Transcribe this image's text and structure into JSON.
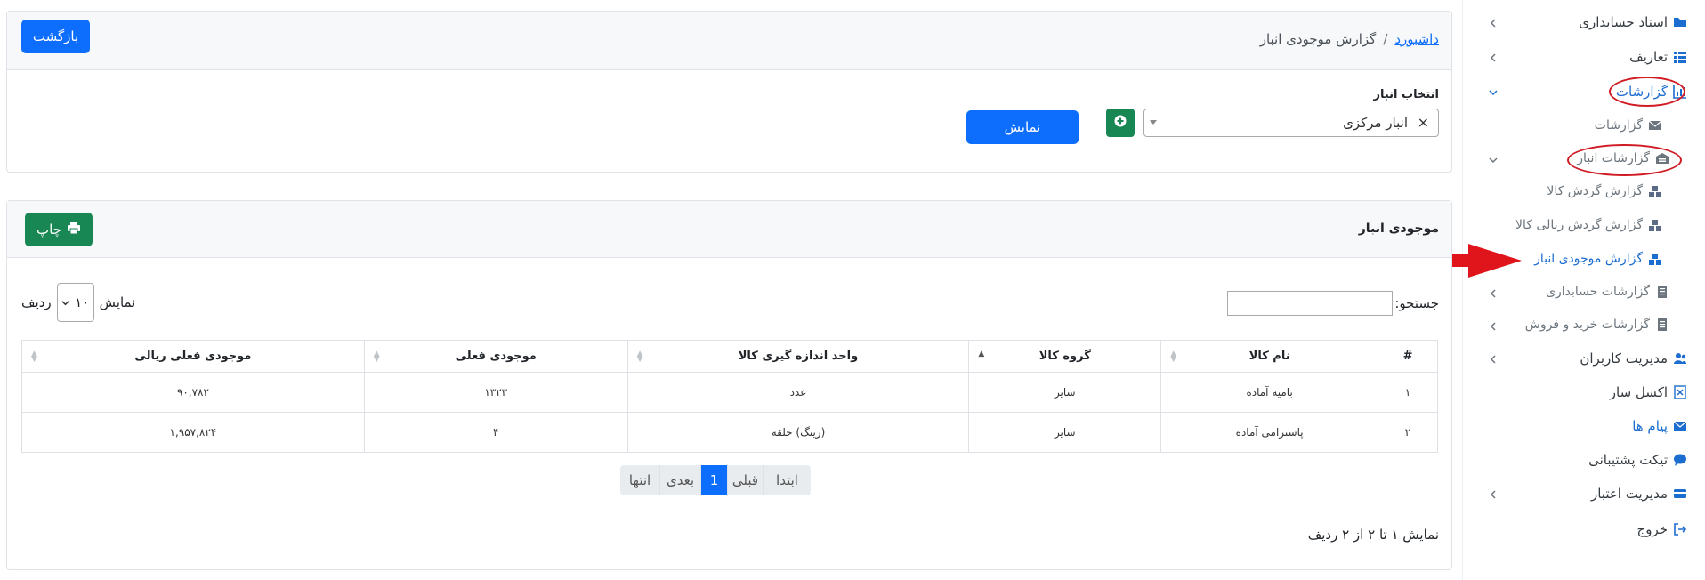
{
  "sidebar": {
    "items": [
      {
        "label": "اسناد حسابداری",
        "icon": "folder-icon"
      },
      {
        "label": "تعاریف",
        "icon": "list-icon"
      },
      {
        "label": "گزارشات",
        "icon": "chart-icon"
      },
      {
        "label": "گزارشات",
        "icon": "envelope-icon"
      },
      {
        "label": "گزارشات انبار",
        "icon": "warehouse-icon"
      },
      {
        "label": "گزارش گردش کالا",
        "icon": "boxes-icon"
      },
      {
        "label": "گزارش گردش ریالی کالا",
        "icon": "boxes-icon"
      },
      {
        "label": "گزارش موجودی انبار",
        "icon": "boxes-icon"
      },
      {
        "label": "گزارشات حسابداری",
        "icon": "file-icon"
      },
      {
        "label": "گزارشات خرید و فروش",
        "icon": "file-icon"
      },
      {
        "label": "مدیریت کاربران",
        "icon": "users-icon"
      },
      {
        "label": "اکسل ساز",
        "icon": "excel-icon"
      },
      {
        "label": "پیام ها",
        "icon": "envelope-icon"
      },
      {
        "label": "تیکت پشتیبانی",
        "icon": "comment-icon"
      },
      {
        "label": "مدیریت اعتبار",
        "icon": "credit-card-icon"
      },
      {
        "label": "خروج",
        "icon": "sign-out-icon"
      }
    ]
  },
  "header": {
    "breadcrumb_home": "داشبورد",
    "breadcrumb_sep": "/",
    "breadcrumb_current": "گزارش موجودی انبار",
    "back_label": "بازگشت"
  },
  "filter": {
    "warehouse_label": "انتخاب انبار",
    "warehouse_value": "انبار مرکزی",
    "clear_glyph": "×",
    "show_label": "نمایش"
  },
  "report": {
    "title": "موجودی انبار",
    "print_label": "چاپ",
    "length_show": "نمایش",
    "length_value": "۱۰",
    "length_rows": "ردیف",
    "search_label": "جستجو:",
    "search_value": "",
    "columns": [
      "#",
      "نام کالا",
      "گروه کالا",
      "واحد اندازه گیری کالا",
      "موجودی فعلی",
      "موجودی فعلی ریالی"
    ],
    "rows": [
      [
        "۱",
        "بامیه آماده",
        "سایر",
        "عدد",
        "۱۳۲۳",
        "۹۰,۷۸۲"
      ],
      [
        "۲",
        "پاسترامی آماده",
        "سایر",
        "(رینگ) حلقه",
        "۴",
        "۱,۹۵۷,۸۲۴"
      ]
    ],
    "pagination": {
      "first": "ابتدا",
      "prev": "قبلی",
      "current": "1",
      "next": "بعدی",
      "last": "انتها"
    },
    "info": "نمایش ۱ تا ۲ از ۲ ردیف"
  },
  "colors": {
    "primary": "#0d6efd",
    "success": "#198754",
    "active_link": "#1c6dd0",
    "annotation_red": "#d01b24"
  }
}
